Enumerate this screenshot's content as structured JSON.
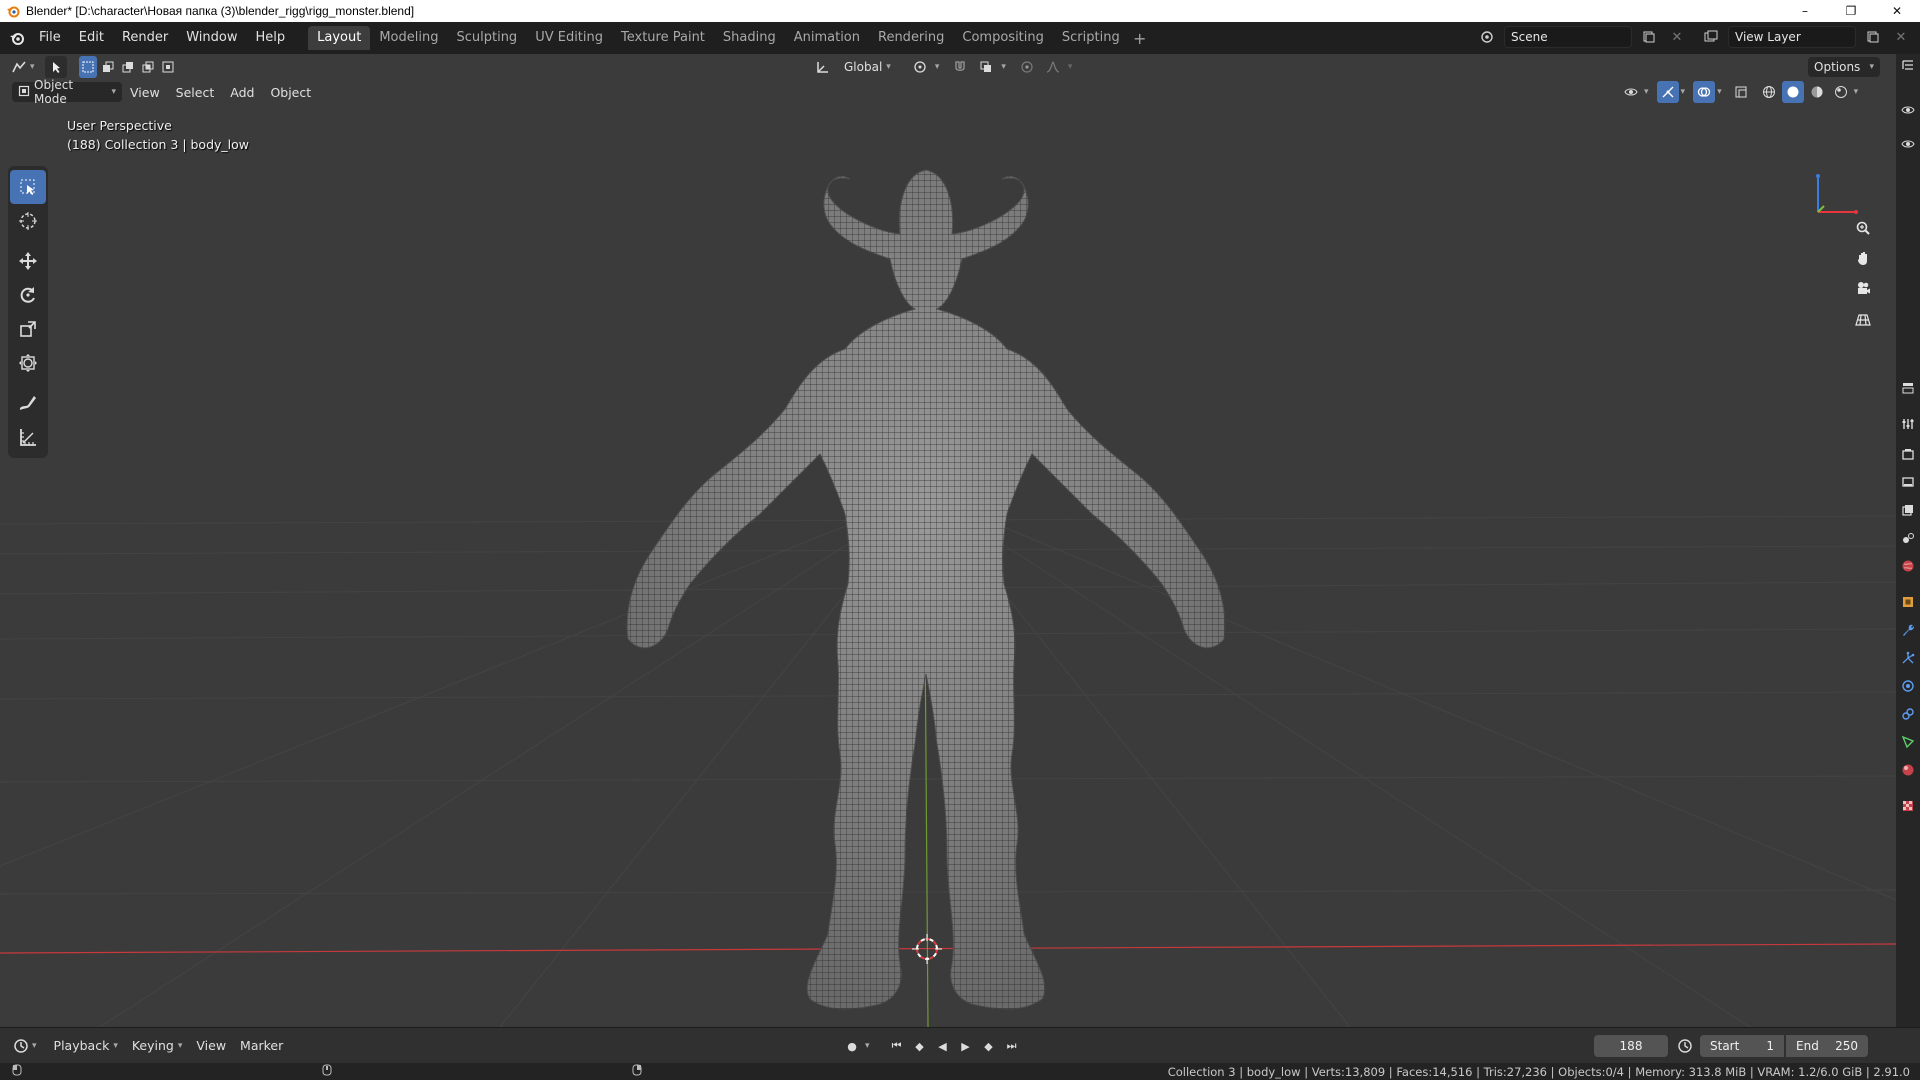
{
  "window": {
    "title": "Blender* [D:\\character\\Новая папка (3)\\blender_rigg\\rigg_monster.blend]",
    "minimize": "–",
    "maximize": "❐",
    "close": "✕"
  },
  "menu": [
    "File",
    "Edit",
    "Render",
    "Window",
    "Help"
  ],
  "workspaces": [
    "Layout",
    "Modeling",
    "Sculpting",
    "UV Editing",
    "Texture Paint",
    "Shading",
    "Animation",
    "Rendering",
    "Compositing",
    "Scripting"
  ],
  "active_workspace": "Layout",
  "scene": {
    "name": "Scene",
    "view_layer": "View Layer"
  },
  "tool_header": {
    "orientation": "Global",
    "options_label": "Options"
  },
  "viewport_header": {
    "mode": "Object Mode",
    "menus": [
      "View",
      "Select",
      "Add",
      "Object"
    ]
  },
  "viewport": {
    "perspective": "User Perspective",
    "context": "(188) Collection 3 | body_low",
    "gizmo_axes": {
      "x_color": "#e8343c",
      "y_color": "#7ac142",
      "z_color": "#3b7ee3"
    }
  },
  "toolbar_tools": [
    "select-box-icon",
    "cursor-icon",
    "move-icon",
    "rotate-icon",
    "scale-icon",
    "transform-icon",
    "annotate-icon",
    "measure-icon"
  ],
  "timeline": {
    "menus": [
      "Playback",
      "Keying",
      "View",
      "Marker"
    ],
    "current_frame": "188",
    "start_label": "Start",
    "start_value": "1",
    "end_label": "End",
    "end_value": "250"
  },
  "statusbar": {
    "stats": "Collection 3 | body_low | Verts:13,809 | Faces:14,516 | Tris:27,236 | Objects:0/4 | Memory: 313.8 MiB | VRAM: 1.2/6.0 GiB | 2.91.0"
  },
  "colors": {
    "accent": "#4772b3",
    "x_axis": "#c8393c",
    "y_axis": "#6f9a35",
    "viewport_bg": "#3b3b3b"
  }
}
